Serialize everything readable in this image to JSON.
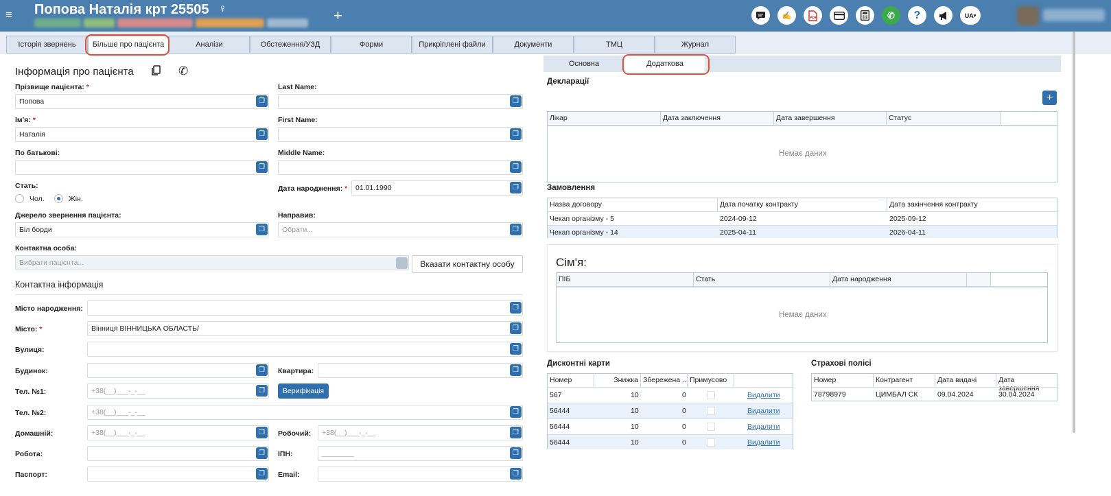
{
  "header": {
    "title": "Попова Наталія крт  25505",
    "gender_symbol": "♀",
    "add_symbol": "+",
    "lang": "UA",
    "icons": [
      "chat-icon",
      "signature-icon",
      "pdf-icon",
      "card-icon",
      "calculator-icon",
      "phone-icon",
      "help-icon",
      "megaphone-icon"
    ],
    "chip_colors": [
      "#6fae8a",
      "#8fbf7a",
      "#d98a8a",
      "#e0a050",
      "#9fb8d0"
    ]
  },
  "tabs": [
    "Історія звернень",
    "Більше про пацієнта",
    "Аналізи",
    "Обстеження/УЗД",
    "Форми",
    "Прикріплені файли",
    "Документи",
    "ТМЦ",
    "Журнал"
  ],
  "info": {
    "title": "Інформація про пацієнта",
    "surname_label": "Прізвище пацієнта:",
    "surname_value": "Попова",
    "name_label": "Ім'я:",
    "name_value": "Наталія",
    "patronymic_label": "По батькові:",
    "patronymic_value": "",
    "lastname_label": "Last Name:",
    "lastname_value": "",
    "firstname_label": "First Name:",
    "firstname_value": "",
    "middlename_label": "Middle Name:",
    "middlename_value": "",
    "sex_label": "Стать:",
    "male": "Чол.",
    "female": "Жін.",
    "dob_label": "Дата народження:",
    "dob_value": "01.01.1990",
    "source_label": "Джерело звернення пацієнта:",
    "source_value": "Біл борди",
    "referred_label": "Направив:",
    "referred_placeholder": "Обрати...",
    "contact_label": "Контактна особа:",
    "contact_placeholder": "Вибрати пацієнта...",
    "contact_button": "Вказати контактну особу"
  },
  "contact": {
    "title": "Контактна інформація",
    "birthplace_label": "Місто народження:",
    "city_label": "Місто:",
    "city_value": "Вінниця  ВІННИЦЬКА ОБЛАСТЬ/",
    "street_label": "Вулиця:",
    "house_label": "Будинок:",
    "apt_label": "Квартира:",
    "tel1_label": "Тел. №1:",
    "tel_mask": "+38(__)___-_-__",
    "verify_button": "Верифікація",
    "tel2_label": "Тел. №2:",
    "home_label": "Домашній:",
    "work_phone_label": "Робочий:",
    "job_label": "Робота:",
    "tin_label": "ІПН:",
    "tin_mask": "________",
    "passport_label": "Паспорт:",
    "email_label": "Email:"
  },
  "subtabs": [
    "Основна",
    "Додаткова"
  ],
  "declarations": {
    "title": "Декларації",
    "columns": [
      "Лікар",
      "Дата заключення",
      "Дата завершення",
      "Статус"
    ],
    "empty": "Немає даних"
  },
  "orders": {
    "title": "Замовлення",
    "columns": [
      "Назва договору",
      "Дата початку контракту",
      "Дата закінчення контракту"
    ],
    "rows": [
      [
        "Чекап організму - 5",
        "2024-09-12",
        "2025-09-12"
      ],
      [
        "Чекап організму - 14",
        "2025-04-11",
        "2026-04-11"
      ]
    ]
  },
  "family": {
    "title": "Сім'я:",
    "columns": [
      "ПІБ",
      "Стать",
      "Дата народження"
    ],
    "empty": "Немає даних"
  },
  "discount": {
    "title": "Дисконтні карти",
    "columns": [
      "Номер",
      "Знижка",
      "Збережена ...",
      "Примусово"
    ],
    "rows": [
      {
        "num": "567",
        "disc": "10",
        "saved": "0",
        "action": "Видалити"
      },
      {
        "num": "56444",
        "disc": "10",
        "saved": "0",
        "action": "Видалити"
      },
      {
        "num": "56444",
        "disc": "10",
        "saved": "0",
        "action": "Видалити"
      },
      {
        "num": "56444",
        "disc": "10",
        "saved": "0",
        "action": "Видалити"
      }
    ]
  },
  "insurance": {
    "title": "Страхові полісі",
    "columns": [
      "Номер",
      "Контрагент",
      "Дата видачі",
      "Дата завершення"
    ],
    "rows": [
      [
        "78798979",
        "ЦИМБАЛ СК",
        "09.04.2024",
        "30.04.2024"
      ]
    ]
  }
}
